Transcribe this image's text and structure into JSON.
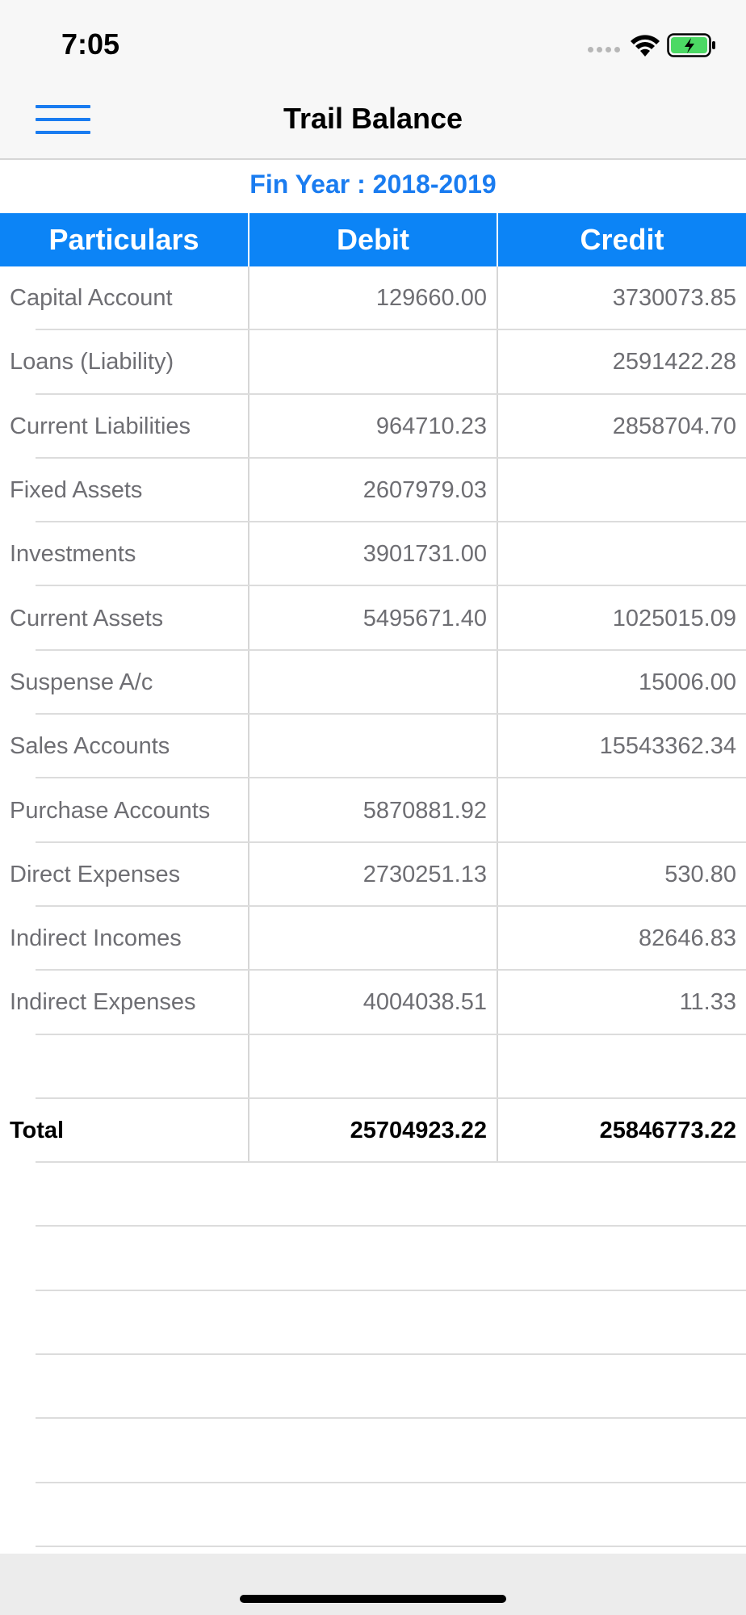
{
  "status_bar": {
    "time": "7:05",
    "icons": [
      "signal-dots-icon",
      "wifi-icon",
      "battery-charging-icon"
    ]
  },
  "nav": {
    "title": "Trail Balance",
    "menu_icon": "hamburger-menu-icon"
  },
  "fin_year": "Fin Year : 2018-2019",
  "colors": {
    "accent": "#1a7cf0",
    "header_bg": "#0c84f6",
    "battery_green": "#4cd964"
  },
  "table": {
    "headers": [
      "Particulars",
      "Debit",
      "Credit"
    ],
    "rows": [
      {
        "particular": "Capital Account",
        "debit": "129660.00",
        "credit": "3730073.85"
      },
      {
        "particular": "Loans (Liability)",
        "debit": "",
        "credit": "2591422.28"
      },
      {
        "particular": "Current Liabilities",
        "debit": "964710.23",
        "credit": "2858704.70"
      },
      {
        "particular": "Fixed Assets",
        "debit": "2607979.03",
        "credit": ""
      },
      {
        "particular": "Investments",
        "debit": "3901731.00",
        "credit": ""
      },
      {
        "particular": "Current Assets",
        "debit": "5495671.40",
        "credit": "1025015.09"
      },
      {
        "particular": "Suspense A/c",
        "debit": "",
        "credit": "15006.00"
      },
      {
        "particular": "Sales Accounts",
        "debit": "",
        "credit": "15543362.34"
      },
      {
        "particular": "Purchase Accounts",
        "debit": "5870881.92",
        "credit": ""
      },
      {
        "particular": "Direct Expenses",
        "debit": "2730251.13",
        "credit": "530.80"
      },
      {
        "particular": "Indirect Incomes",
        "debit": "",
        "credit": "82646.83"
      },
      {
        "particular": "Indirect Expenses",
        "debit": "4004038.51",
        "credit": "11.33"
      },
      {
        "particular": "",
        "debit": "",
        "credit": ""
      }
    ],
    "total": {
      "label": "Total",
      "debit": "25704923.22",
      "credit": "25846773.22"
    }
  }
}
